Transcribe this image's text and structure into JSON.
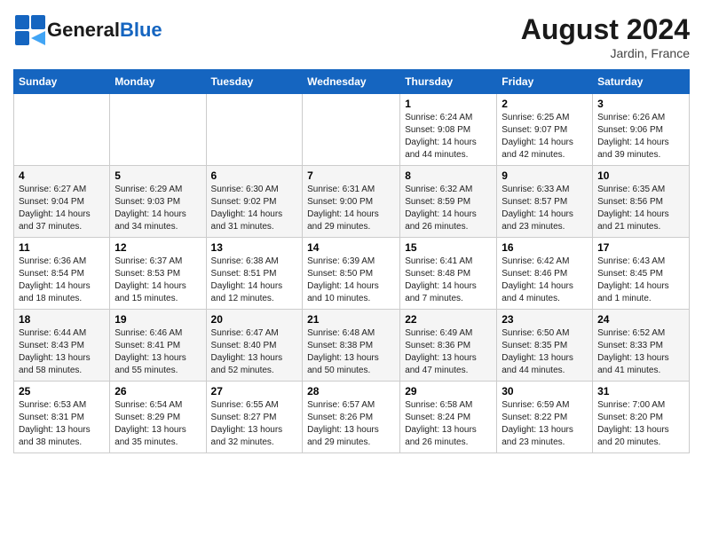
{
  "logo": {
    "text_general": "General",
    "text_blue": "Blue"
  },
  "header": {
    "month_year": "August 2024",
    "location": "Jardin, France"
  },
  "days_of_week": [
    "Sunday",
    "Monday",
    "Tuesday",
    "Wednesday",
    "Thursday",
    "Friday",
    "Saturday"
  ],
  "weeks": [
    [
      {
        "day": "",
        "info": ""
      },
      {
        "day": "",
        "info": ""
      },
      {
        "day": "",
        "info": ""
      },
      {
        "day": "",
        "info": ""
      },
      {
        "day": "1",
        "info": "Sunrise: 6:24 AM\nSunset: 9:08 PM\nDaylight: 14 hours\nand 44 minutes."
      },
      {
        "day": "2",
        "info": "Sunrise: 6:25 AM\nSunset: 9:07 PM\nDaylight: 14 hours\nand 42 minutes."
      },
      {
        "day": "3",
        "info": "Sunrise: 6:26 AM\nSunset: 9:06 PM\nDaylight: 14 hours\nand 39 minutes."
      }
    ],
    [
      {
        "day": "4",
        "info": "Sunrise: 6:27 AM\nSunset: 9:04 PM\nDaylight: 14 hours\nand 37 minutes."
      },
      {
        "day": "5",
        "info": "Sunrise: 6:29 AM\nSunset: 9:03 PM\nDaylight: 14 hours\nand 34 minutes."
      },
      {
        "day": "6",
        "info": "Sunrise: 6:30 AM\nSunset: 9:02 PM\nDaylight: 14 hours\nand 31 minutes."
      },
      {
        "day": "7",
        "info": "Sunrise: 6:31 AM\nSunset: 9:00 PM\nDaylight: 14 hours\nand 29 minutes."
      },
      {
        "day": "8",
        "info": "Sunrise: 6:32 AM\nSunset: 8:59 PM\nDaylight: 14 hours\nand 26 minutes."
      },
      {
        "day": "9",
        "info": "Sunrise: 6:33 AM\nSunset: 8:57 PM\nDaylight: 14 hours\nand 23 minutes."
      },
      {
        "day": "10",
        "info": "Sunrise: 6:35 AM\nSunset: 8:56 PM\nDaylight: 14 hours\nand 21 minutes."
      }
    ],
    [
      {
        "day": "11",
        "info": "Sunrise: 6:36 AM\nSunset: 8:54 PM\nDaylight: 14 hours\nand 18 minutes."
      },
      {
        "day": "12",
        "info": "Sunrise: 6:37 AM\nSunset: 8:53 PM\nDaylight: 14 hours\nand 15 minutes."
      },
      {
        "day": "13",
        "info": "Sunrise: 6:38 AM\nSunset: 8:51 PM\nDaylight: 14 hours\nand 12 minutes."
      },
      {
        "day": "14",
        "info": "Sunrise: 6:39 AM\nSunset: 8:50 PM\nDaylight: 14 hours\nand 10 minutes."
      },
      {
        "day": "15",
        "info": "Sunrise: 6:41 AM\nSunset: 8:48 PM\nDaylight: 14 hours\nand 7 minutes."
      },
      {
        "day": "16",
        "info": "Sunrise: 6:42 AM\nSunset: 8:46 PM\nDaylight: 14 hours\nand 4 minutes."
      },
      {
        "day": "17",
        "info": "Sunrise: 6:43 AM\nSunset: 8:45 PM\nDaylight: 14 hours\nand 1 minute."
      }
    ],
    [
      {
        "day": "18",
        "info": "Sunrise: 6:44 AM\nSunset: 8:43 PM\nDaylight: 13 hours\nand 58 minutes."
      },
      {
        "day": "19",
        "info": "Sunrise: 6:46 AM\nSunset: 8:41 PM\nDaylight: 13 hours\nand 55 minutes."
      },
      {
        "day": "20",
        "info": "Sunrise: 6:47 AM\nSunset: 8:40 PM\nDaylight: 13 hours\nand 52 minutes."
      },
      {
        "day": "21",
        "info": "Sunrise: 6:48 AM\nSunset: 8:38 PM\nDaylight: 13 hours\nand 50 minutes."
      },
      {
        "day": "22",
        "info": "Sunrise: 6:49 AM\nSunset: 8:36 PM\nDaylight: 13 hours\nand 47 minutes."
      },
      {
        "day": "23",
        "info": "Sunrise: 6:50 AM\nSunset: 8:35 PM\nDaylight: 13 hours\nand 44 minutes."
      },
      {
        "day": "24",
        "info": "Sunrise: 6:52 AM\nSunset: 8:33 PM\nDaylight: 13 hours\nand 41 minutes."
      }
    ],
    [
      {
        "day": "25",
        "info": "Sunrise: 6:53 AM\nSunset: 8:31 PM\nDaylight: 13 hours\nand 38 minutes."
      },
      {
        "day": "26",
        "info": "Sunrise: 6:54 AM\nSunset: 8:29 PM\nDaylight: 13 hours\nand 35 minutes."
      },
      {
        "day": "27",
        "info": "Sunrise: 6:55 AM\nSunset: 8:27 PM\nDaylight: 13 hours\nand 32 minutes."
      },
      {
        "day": "28",
        "info": "Sunrise: 6:57 AM\nSunset: 8:26 PM\nDaylight: 13 hours\nand 29 minutes."
      },
      {
        "day": "29",
        "info": "Sunrise: 6:58 AM\nSunset: 8:24 PM\nDaylight: 13 hours\nand 26 minutes."
      },
      {
        "day": "30",
        "info": "Sunrise: 6:59 AM\nSunset: 8:22 PM\nDaylight: 13 hours\nand 23 minutes."
      },
      {
        "day": "31",
        "info": "Sunrise: 7:00 AM\nSunset: 8:20 PM\nDaylight: 13 hours\nand 20 minutes."
      }
    ]
  ]
}
